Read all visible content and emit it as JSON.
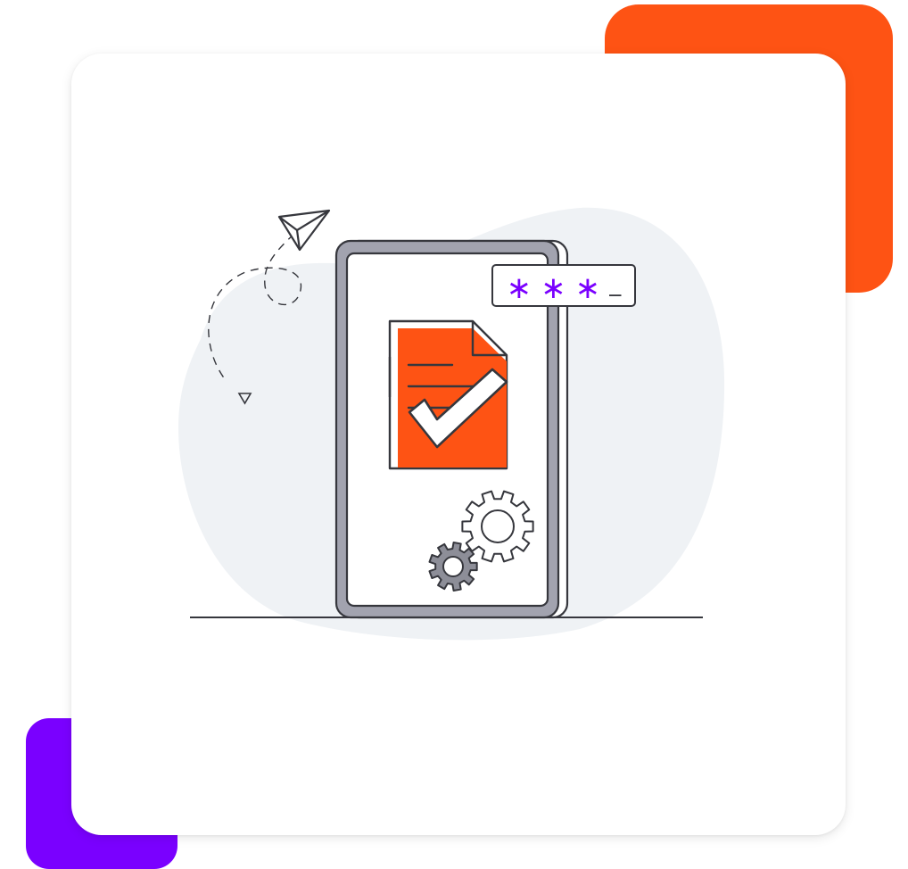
{
  "colors": {
    "accent_orange": "#fe5314",
    "accent_purple": "#7a00ff",
    "card_background": "#ffffff",
    "blob_background": "#eff2f5",
    "outline": "#36373d",
    "device_frame": "#a2a3af",
    "document_fill": "#fe5314",
    "gear_fill_small": "#8d8e98",
    "password_char": "#7a00ff"
  },
  "icons": {
    "paper_plane": "paper-plane-icon",
    "document_check": "document-check-icon",
    "gear_large": "gear-icon",
    "gear_small": "gear-icon",
    "phone": "tablet-device-icon"
  },
  "password_field": {
    "mask_chars": [
      "∗",
      "∗",
      "∗"
    ],
    "cursor": "_"
  }
}
